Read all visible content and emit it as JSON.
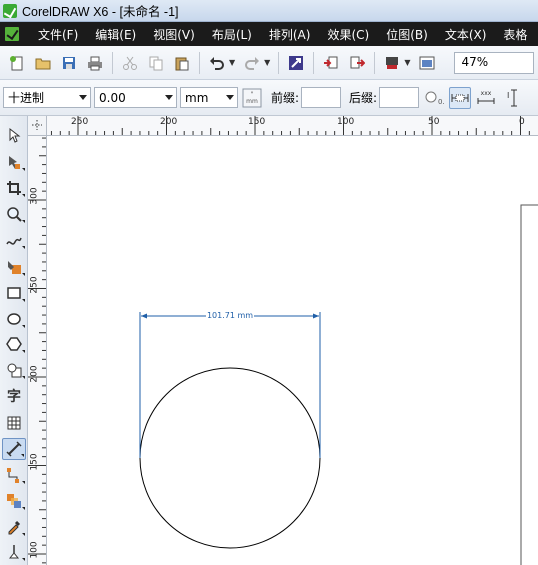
{
  "window": {
    "title": "CorelDRAW X6 - [未命名 -1]"
  },
  "menu": {
    "items": [
      "文件(F)",
      "编辑(E)",
      "视图(V)",
      "布局(L)",
      "排列(A)",
      "效果(C)",
      "位图(B)",
      "文本(X)",
      "表格"
    ]
  },
  "standard_toolbar": {
    "icons": [
      "new-icon",
      "open-icon",
      "save-icon",
      "print-icon",
      "cut-icon",
      "copy-icon",
      "paste-icon",
      "undo-icon",
      "redo-icon",
      "search-content-icon",
      "import-icon",
      "export-icon",
      "publish-pdf-icon",
      "welcome-screen-icon"
    ],
    "zoom": "47%"
  },
  "property_bar": {
    "units_style": "十进制",
    "value": "0.00",
    "units": "mm",
    "prefix_label": "前缀:",
    "suffix_label": "后缀:"
  },
  "toolbox": {
    "tools": [
      "pick-tool",
      "shape-tool",
      "crop-tool",
      "zoom-tool",
      "freehand-tool",
      "smart-fill-tool",
      "rectangle-tool",
      "ellipse-tool",
      "polygon-tool",
      "basic-shapes-tool",
      "text-tool",
      "table-tool",
      "dimension-tool",
      "connector-tool",
      "blend-tool",
      "eyedropper-tool",
      "outline-tool"
    ],
    "text_tool_glyph": "字",
    "active_tool": "dimension-tool"
  },
  "rulers": {
    "horizontal_labels": [
      "250",
      "200",
      "150",
      "100",
      "50",
      "0"
    ],
    "vertical_labels": [
      "300",
      "250",
      "200",
      "150",
      "100"
    ]
  },
  "drawing": {
    "dimension_label": "101.71 mm",
    "dimension_color": "#1f5fa8"
  }
}
